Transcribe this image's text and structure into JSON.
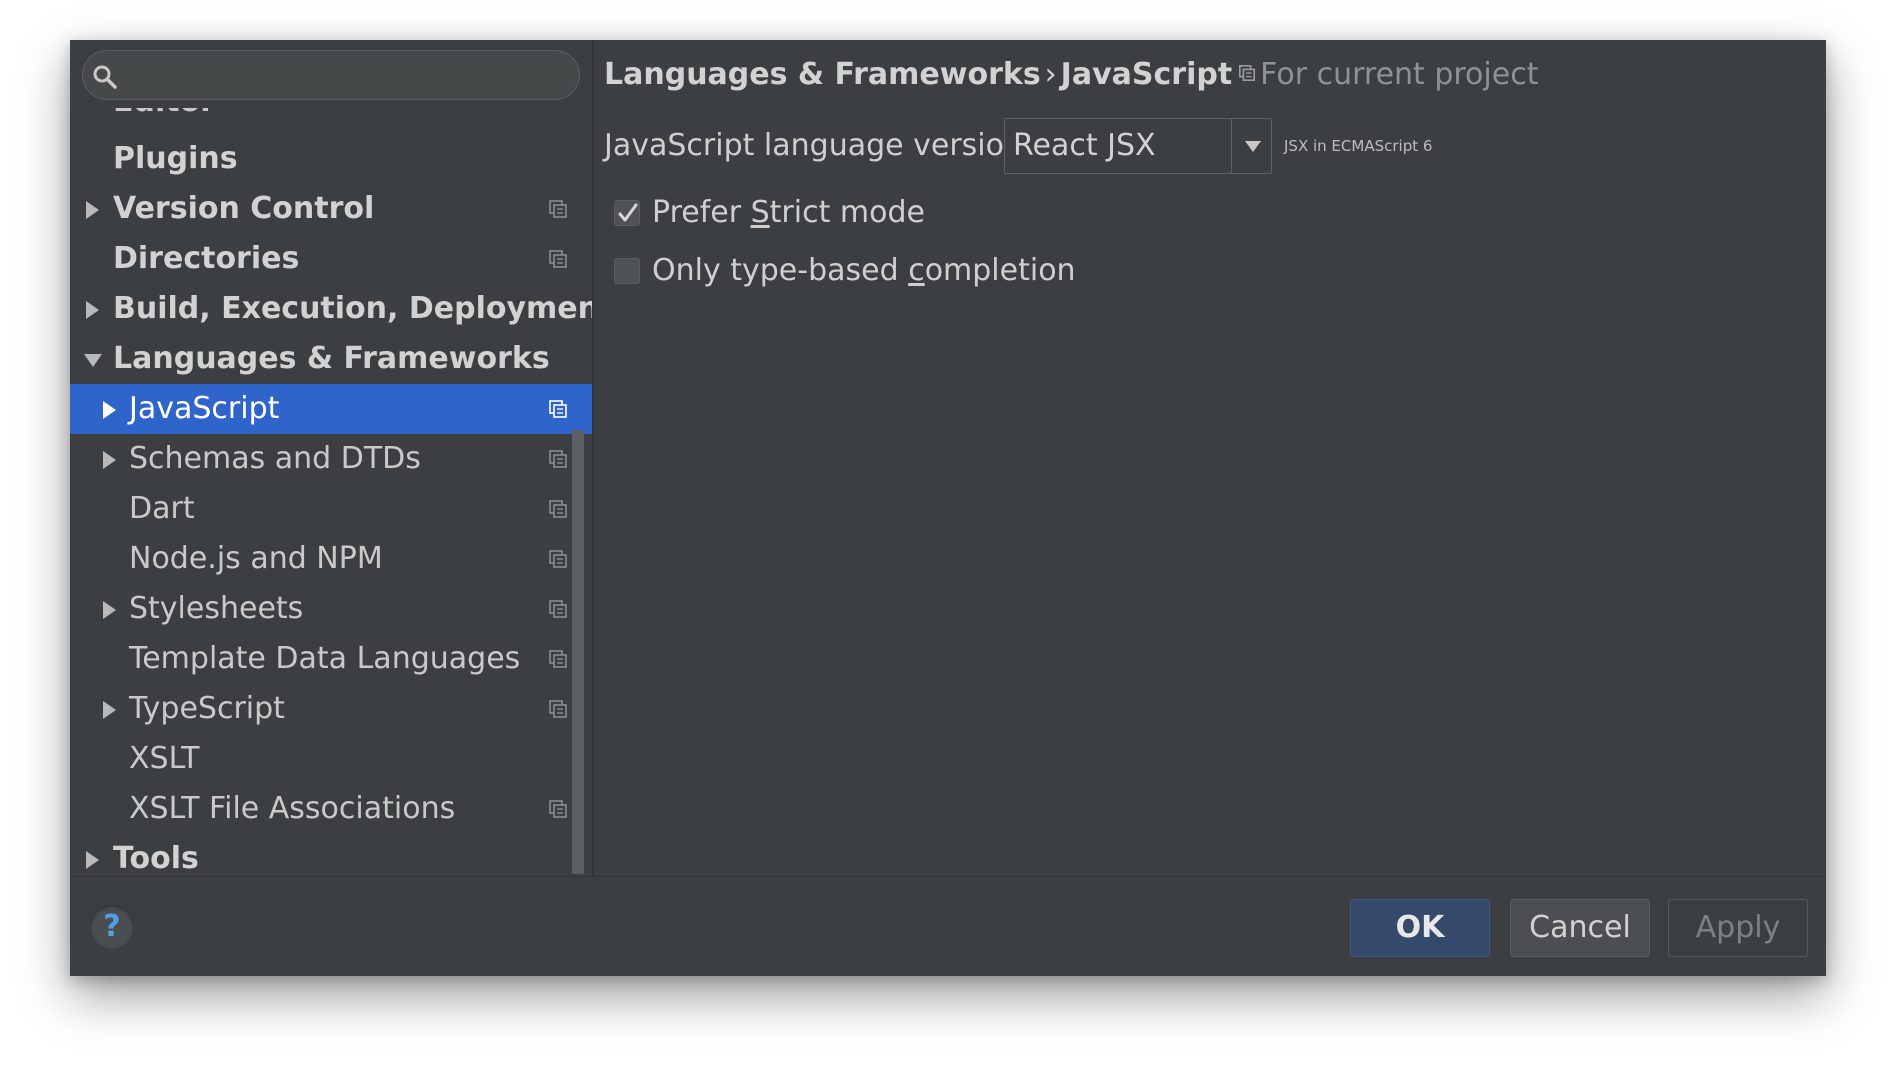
{
  "search": {
    "placeholder": ""
  },
  "sidebar": {
    "clipped_label": "Editor",
    "items": [
      {
        "label": "Plugins"
      },
      {
        "label": "Version Control"
      },
      {
        "label": "Directories"
      },
      {
        "label": "Build, Execution, Deployment"
      },
      {
        "label": "Languages & Frameworks"
      },
      {
        "label": "JavaScript"
      },
      {
        "label": "Schemas and DTDs"
      },
      {
        "label": "Dart"
      },
      {
        "label": "Node.js and NPM"
      },
      {
        "label": "Stylesheets"
      },
      {
        "label": "Template Data Languages"
      },
      {
        "label": "TypeScript"
      },
      {
        "label": "XSLT"
      },
      {
        "label": "XSLT File Associations"
      },
      {
        "label": "Tools"
      }
    ]
  },
  "breadcrumb": {
    "parent": "Languages & Frameworks",
    "separator": "›",
    "current": "JavaScript",
    "scope": "For current project"
  },
  "settings": {
    "language_version_label": "JavaScript language version",
    "language_version_value": "React JSX",
    "language_version_hint": "JSX in ECMAScript 6",
    "strict_mode": {
      "pre": "Prefer ",
      "mnemonic": "S",
      "post": "trict mode",
      "checked": true
    },
    "type_completion": {
      "pre": "Only type-based ",
      "mnemonic": "c",
      "post": "ompletion",
      "checked": false
    }
  },
  "footer": {
    "help": "?",
    "ok": "OK",
    "cancel": "Cancel",
    "apply": "Apply"
  },
  "colors": {
    "selection": "#2f65ca",
    "panel": "#3c3f41",
    "help_accent": "#4f9ee6"
  }
}
